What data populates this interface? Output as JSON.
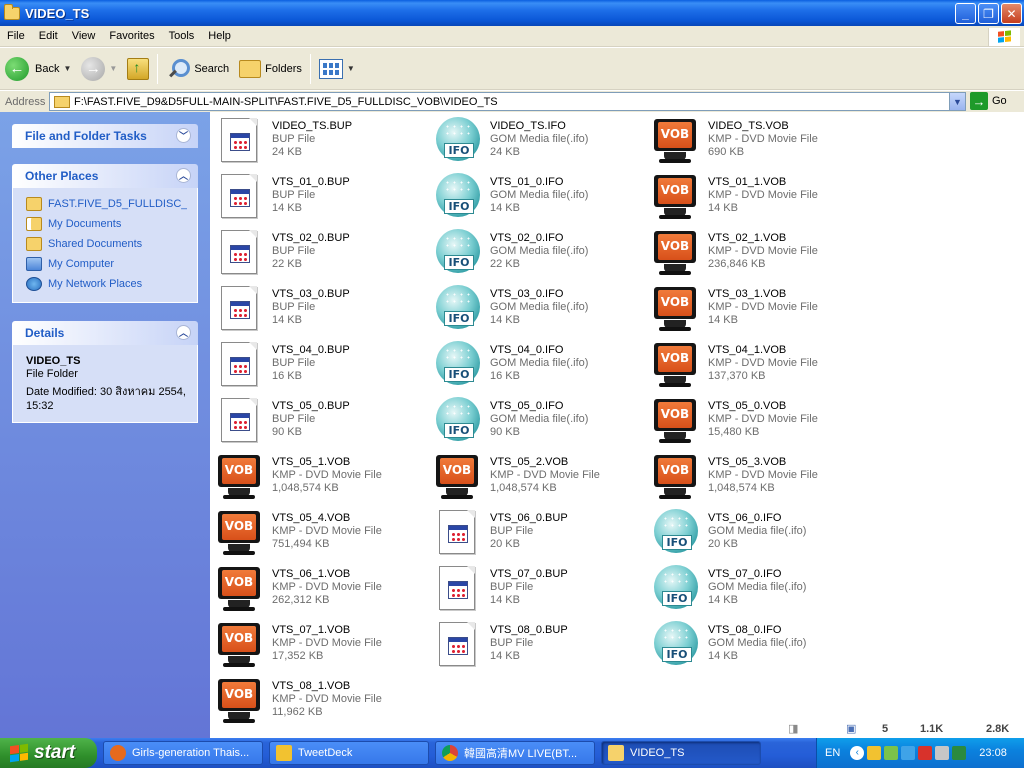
{
  "window": {
    "title": "VIDEO_TS"
  },
  "menu": [
    "File",
    "Edit",
    "View",
    "Favorites",
    "Tools",
    "Help"
  ],
  "toolbar": {
    "back": "Back",
    "search": "Search",
    "folders": "Folders"
  },
  "address": {
    "label": "Address",
    "path": "F:\\FAST.FIVE_D9&D5FULL-MAIN-SPLIT\\FAST.FIVE_D5_FULLDISC_VOB\\VIDEO_TS",
    "go": "Go"
  },
  "taskpane": {
    "file_tasks": {
      "title": "File and Folder Tasks"
    },
    "other_places": {
      "title": "Other Places",
      "items": [
        {
          "label": "FAST.FIVE_D5_FULLDISC_\\",
          "icon": "folder-icon"
        },
        {
          "label": "My Documents",
          "icon": "my-documents-icon"
        },
        {
          "label": "Shared Documents",
          "icon": "folder-icon"
        },
        {
          "label": "My Computer",
          "icon": "computer-icon"
        },
        {
          "label": "My Network Places",
          "icon": "network-icon"
        }
      ]
    },
    "details": {
      "title": "Details",
      "name": "VIDEO_TS",
      "type": "File Folder",
      "modified": "Date Modified: 30 สิงหาคม 2554, 15:32"
    }
  },
  "files": [
    {
      "name": "VIDEO_TS.BUP",
      "type": "BUP File",
      "size": "24 KB",
      "kind": "bup"
    },
    {
      "name": "VIDEO_TS.IFO",
      "type": "GOM Media file(.ifo)",
      "size": "24 KB",
      "kind": "ifo"
    },
    {
      "name": "VIDEO_TS.VOB",
      "type": "KMP - DVD Movie File",
      "size": "690 KB",
      "kind": "vob"
    },
    {
      "name": "VTS_01_0.BUP",
      "type": "BUP File",
      "size": "14 KB",
      "kind": "bup"
    },
    {
      "name": "VTS_01_0.IFO",
      "type": "GOM Media file(.ifo)",
      "size": "14 KB",
      "kind": "ifo"
    },
    {
      "name": "VTS_01_1.VOB",
      "type": "KMP - DVD Movie File",
      "size": "14 KB",
      "kind": "vob"
    },
    {
      "name": "VTS_02_0.BUP",
      "type": "BUP File",
      "size": "22 KB",
      "kind": "bup"
    },
    {
      "name": "VTS_02_0.IFO",
      "type": "GOM Media file(.ifo)",
      "size": "22 KB",
      "kind": "ifo"
    },
    {
      "name": "VTS_02_1.VOB",
      "type": "KMP - DVD Movie File",
      "size": "236,846 KB",
      "kind": "vob"
    },
    {
      "name": "VTS_03_0.BUP",
      "type": "BUP File",
      "size": "14 KB",
      "kind": "bup"
    },
    {
      "name": "VTS_03_0.IFO",
      "type": "GOM Media file(.ifo)",
      "size": "14 KB",
      "kind": "ifo"
    },
    {
      "name": "VTS_03_1.VOB",
      "type": "KMP - DVD Movie File",
      "size": "14 KB",
      "kind": "vob"
    },
    {
      "name": "VTS_04_0.BUP",
      "type": "BUP File",
      "size": "16 KB",
      "kind": "bup"
    },
    {
      "name": "VTS_04_0.IFO",
      "type": "GOM Media file(.ifo)",
      "size": "16 KB",
      "kind": "ifo"
    },
    {
      "name": "VTS_04_1.VOB",
      "type": "KMP - DVD Movie File",
      "size": "137,370 KB",
      "kind": "vob"
    },
    {
      "name": "VTS_05_0.BUP",
      "type": "BUP File",
      "size": "90 KB",
      "kind": "bup"
    },
    {
      "name": "VTS_05_0.IFO",
      "type": "GOM Media file(.ifo)",
      "size": "90 KB",
      "kind": "ifo"
    },
    {
      "name": "VTS_05_0.VOB",
      "type": "KMP - DVD Movie File",
      "size": "15,480 KB",
      "kind": "vob"
    },
    {
      "name": "VTS_05_1.VOB",
      "type": "KMP - DVD Movie File",
      "size": "1,048,574 KB",
      "kind": "vob"
    },
    {
      "name": "VTS_05_2.VOB",
      "type": "KMP - DVD Movie File",
      "size": "1,048,574 KB",
      "kind": "vob"
    },
    {
      "name": "VTS_05_3.VOB",
      "type": "KMP - DVD Movie File",
      "size": "1,048,574 KB",
      "kind": "vob"
    },
    {
      "name": "VTS_05_4.VOB",
      "type": "KMP - DVD Movie File",
      "size": "751,494 KB",
      "kind": "vob"
    },
    {
      "name": "VTS_06_0.BUP",
      "type": "BUP File",
      "size": "20 KB",
      "kind": "bup"
    },
    {
      "name": "VTS_06_0.IFO",
      "type": "GOM Media file(.ifo)",
      "size": "20 KB",
      "kind": "ifo"
    },
    {
      "name": "VTS_06_1.VOB",
      "type": "KMP - DVD Movie File",
      "size": "262,312 KB",
      "kind": "vob"
    },
    {
      "name": "VTS_07_0.BUP",
      "type": "BUP File",
      "size": "14 KB",
      "kind": "bup"
    },
    {
      "name": "VTS_07_0.IFO",
      "type": "GOM Media file(.ifo)",
      "size": "14 KB",
      "kind": "ifo"
    },
    {
      "name": "VTS_07_1.VOB",
      "type": "KMP - DVD Movie File",
      "size": "17,352 KB",
      "kind": "vob"
    },
    {
      "name": "VTS_08_0.BUP",
      "type": "BUP File",
      "size": "14 KB",
      "kind": "bup"
    },
    {
      "name": "VTS_08_0.IFO",
      "type": "GOM Media file(.ifo)",
      "size": "14 KB",
      "kind": "ifo"
    },
    {
      "name": "VTS_08_1.VOB",
      "type": "KMP - DVD Movie File",
      "size": "11,962 KB",
      "kind": "vob"
    }
  ],
  "statusmini": {
    "count": "5",
    "size_a": "1.1K",
    "size_b": "2.8K"
  },
  "taskbar": {
    "start": "start",
    "tasks": [
      {
        "label": "Girls-generation Thais...",
        "icon": "firefox-icon",
        "color": "#e66a1e"
      },
      {
        "label": "TweetDeck",
        "icon": "tweetdeck-icon",
        "color": "#f2c230"
      },
      {
        "label": "韓國高清MV LIVE(BT...",
        "icon": "chrome-icon",
        "color": "#4a9d3b"
      },
      {
        "label": "VIDEO_TS",
        "icon": "folder-icon",
        "color": "#f6d26b"
      }
    ],
    "lang": "EN",
    "clock": "23:08"
  }
}
